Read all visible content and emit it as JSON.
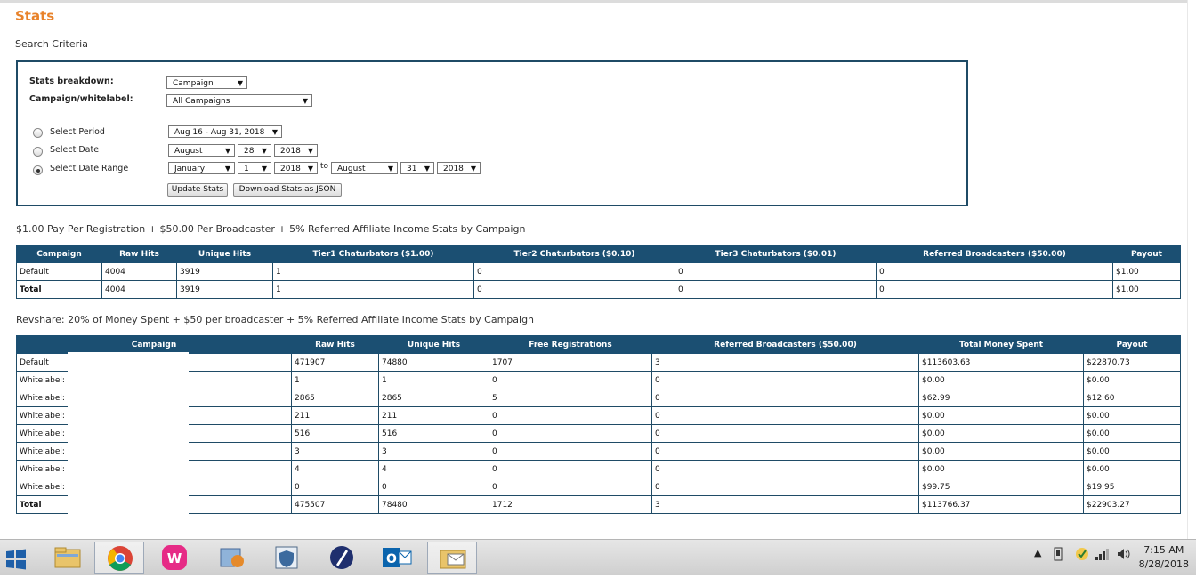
{
  "page": {
    "title": "Stats",
    "search_label": "Search Criteria"
  },
  "criteria": {
    "breakdown_label": "Stats breakdown:",
    "breakdown_value": "Campaign",
    "campaign_label": "Campaign/whitelabel:",
    "campaign_value": "All Campaigns",
    "select_period_label": "Select Period",
    "period_value": "Aug 16 - Aug 31, 2018",
    "select_date_label": "Select Date",
    "date_month": "August",
    "date_day": "28",
    "date_year": "2018",
    "select_date_range_label": "Select Date Range",
    "range_from_month": "January",
    "range_from_day": "1",
    "range_from_year": "2018",
    "to_label": "to",
    "range_to_month": "August",
    "range_to_day": "31",
    "range_to_year": "2018",
    "selected_option": "Select Date Range",
    "update_button": "Update Stats",
    "download_button": "Download Stats as JSON"
  },
  "table1": {
    "caption": "$1.00 Pay Per Registration + $50.00 Per Broadcaster + 5% Referred Affiliate Income Stats by Campaign",
    "headers": [
      "Campaign",
      "Raw Hits",
      "Unique Hits",
      "Tier1 Chaturbators ($1.00)",
      "Tier2 Chaturbators ($0.10)",
      "Tier3 Chaturbators ($0.01)",
      "Referred Broadcasters ($50.00)",
      "Payout"
    ],
    "rows": [
      [
        "Default",
        "4004",
        "3919",
        "1",
        "0",
        "0",
        "0",
        "$1.00"
      ],
      [
        "Total",
        "4004",
        "3919",
        "1",
        "0",
        "0",
        "0",
        "$1.00"
      ]
    ]
  },
  "table2": {
    "caption": "Revshare: 20% of Money Spent + $50 per broadcaster + 5% Referred Affiliate Income Stats by Campaign",
    "headers": [
      "Campaign",
      "Raw Hits",
      "Unique Hits",
      "Free Registrations",
      "Referred Broadcasters ($50.00)",
      "Total Money Spent",
      "Payout"
    ],
    "rows": [
      [
        "Default",
        "471907",
        "74880",
        "1707",
        "3",
        "$113603.63",
        "$22870.73"
      ],
      [
        "Whitelabel:",
        "1",
        "1",
        "0",
        "0",
        "$0.00",
        "$0.00"
      ],
      [
        "Whitelabel:",
        "2865",
        "2865",
        "5",
        "0",
        "$62.99",
        "$12.60"
      ],
      [
        "Whitelabel:",
        "211",
        "211",
        "0",
        "0",
        "$0.00",
        "$0.00"
      ],
      [
        "Whitelabel:",
        "516",
        "516",
        "0",
        "0",
        "$0.00",
        "$0.00"
      ],
      [
        "Whitelabel:",
        "3",
        "3",
        "0",
        "0",
        "$0.00",
        "$0.00"
      ],
      [
        "Whitelabel:",
        "4",
        "4",
        "0",
        "0",
        "$0.00",
        "$0.00"
      ],
      [
        "Whitelabel:",
        "0",
        "0",
        "0",
        "0",
        "$99.75",
        "$19.95"
      ],
      [
        "Total",
        "475507",
        "78480",
        "1712",
        "3",
        "$113766.37",
        "$22903.27"
      ]
    ]
  },
  "taskbar": {
    "apps": [
      "start-icon",
      "file-explorer-icon",
      "chrome-icon",
      "wampserver-icon",
      "app-icon",
      "security-shield-icon",
      "app-slash-icon",
      "outlook-icon",
      "mail-folder-icon"
    ],
    "time": "7:15 AM",
    "date": "8/28/2018"
  },
  "colors": {
    "title": "#e8822a",
    "table_header": "#1b4f72",
    "box_border": "#1f4b66"
  }
}
